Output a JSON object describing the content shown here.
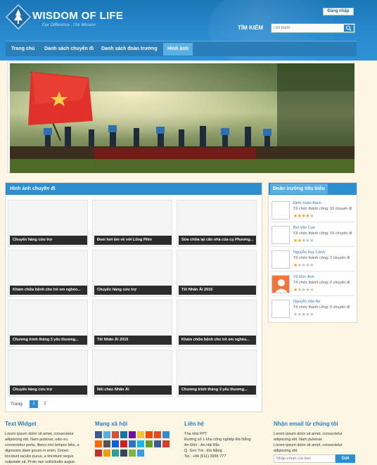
{
  "header": {
    "logo_title": "WISDOM OF LIFE",
    "logo_slogan": "Our Difference , Our Mission",
    "login_label": "Đăng nhập",
    "search_label": "TÌM KIẾM",
    "search_placeholder": "Tìm kiếm"
  },
  "nav": {
    "items": [
      {
        "label": "Trang chủ"
      },
      {
        "label": "Danh sách chuyến đi"
      },
      {
        "label": "Danh sách đoàn trưởng"
      },
      {
        "label": "Hình ảnh"
      }
    ],
    "active_index": 3
  },
  "gallery": {
    "title": "Hình ảnh chuyến đi",
    "tiles": [
      {
        "caption": "Chuyến hàng cứu trợ"
      },
      {
        "caption": "Đem hơi ấm về với Lũng Phìn"
      },
      {
        "caption": "Sửa chữa lại căn nhà của cụ Phương..."
      },
      {
        "caption": "Khám chữa bệnh cho trẻ em nghèo..."
      },
      {
        "caption": "Chuyến hàng cứu trợ"
      },
      {
        "caption": "Tết Nhân Ái 2015"
      },
      {
        "caption": "Chương trình tháng 3 yêu thương..."
      },
      {
        "caption": "Tết Nhân Ái 2015"
      },
      {
        "caption": "Khám chữa bệnh cho trẻ em nghèo..."
      },
      {
        "caption": "Chuyến hàng cứu trợ"
      },
      {
        "caption": "Nối chào Nhân Ái"
      },
      {
        "caption": "Chương trình tháng 3 yêu thương..."
      }
    ],
    "pager_label": "Trang",
    "pages": [
      "1",
      "2"
    ],
    "current_page": "1"
  },
  "sidebar": {
    "title": "Đoàn trưởng tiêu biểu",
    "leaders": [
      {
        "name": "Đinh Xuân Bách",
        "stat": "Tổ chức thành công: 33 chuyến đi",
        "rating": 4,
        "avatar": "blank"
      },
      {
        "name": "Bùi Văn Cao",
        "stat": "Tổ chức thành công: 14 chuyến đi",
        "rating": 2,
        "avatar": "blank"
      },
      {
        "name": "Nguyễn Huy Cảnh",
        "stat": "Tổ chức thành công: 2 chuyến đi",
        "rating": 1,
        "avatar": "blank"
      },
      {
        "name": "Võ Đức Anh",
        "stat": "Tổ chức thành công: 0 chuyến đi",
        "rating": 1,
        "avatar": "orange"
      },
      {
        "name": "Nguyễn Văn An",
        "stat": "Tổ chức thành công: 0 chuyến đi",
        "rating": 0,
        "avatar": "blank"
      }
    ]
  },
  "footer": {
    "text_widget_title": "Text Widget",
    "text_widget_body": [
      "Lorem ipsum dolor sit amet, consectetur",
      "adipiscing elit. Nam pulvinar, odio eu",
      "consectetur porta, libero orci tempor felis, a",
      "dignissim diam ipsum in enim. Donec",
      "tincidunt iaculis purus, a tincidunt neque",
      "vulputate sit. Proin nec sollicitudin augue."
    ],
    "social_title": "Mạng xã hội",
    "contact_title": "Liên hệ",
    "contact_lines": [
      "Tòa nhà FPT",
      "Đường số 1 khu công nghiệp Đà Nẵng",
      "An Đồn - An Hải Bắc",
      "Q. Sơn Trà - Đà Nẵng",
      "Tel.: +84 (511) 3955 777"
    ],
    "newsletter_title": "Nhận email từ chúng tôi",
    "newsletter_lines": [
      "Lorem ipsum dolor sit amet, consectetur",
      "adipiscing elit. Nam pulvinar.",
      "Lorem ipsum dolor sit amet, consectetur",
      "adipiscing elit."
    ],
    "newsletter_placeholder": "Nhập email của bạn",
    "newsletter_button": "Gửi"
  },
  "colors": {
    "header": "#2a8bd0",
    "nav": "#2a7fb9",
    "accent": "#2b8fd1",
    "background": "#fdf6e3"
  },
  "icons": [
    "globe-icon",
    "search-icon",
    "star-icon"
  ]
}
